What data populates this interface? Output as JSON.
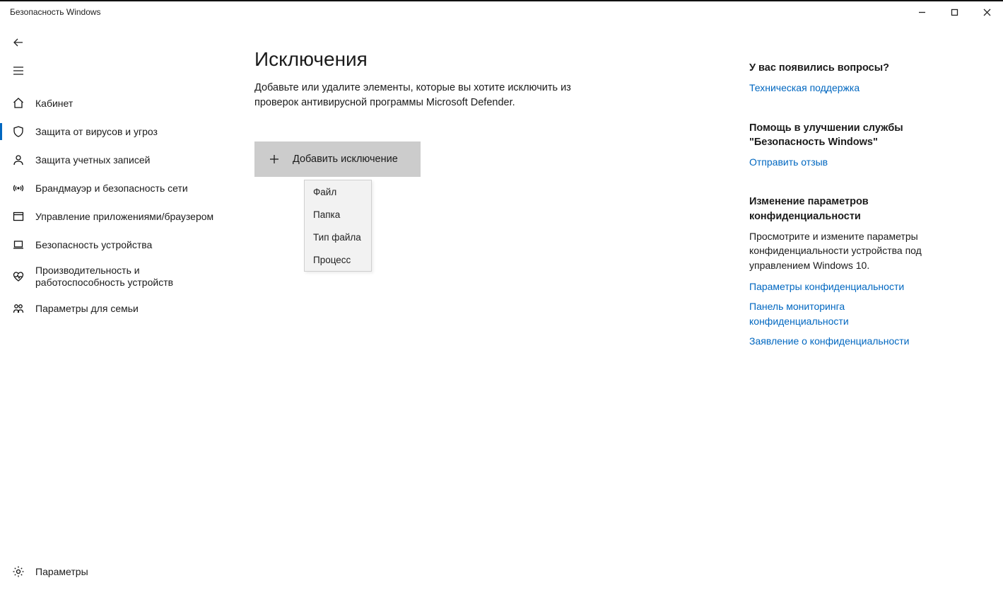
{
  "window": {
    "title": "Безопасность Windows"
  },
  "sidebar": {
    "items": [
      {
        "id": "home",
        "label": "Кабинет"
      },
      {
        "id": "virus",
        "label": "Защита от вирусов и угроз"
      },
      {
        "id": "account",
        "label": "Защита учетных записей"
      },
      {
        "id": "firewall",
        "label": "Брандмауэр и безопасность сети"
      },
      {
        "id": "appbrowser",
        "label": "Управление приложениями/браузером"
      },
      {
        "id": "device",
        "label": "Безопасность устройства"
      },
      {
        "id": "perf",
        "label": "Производительность и работоспособность устройств"
      },
      {
        "id": "family",
        "label": "Параметры для семьи"
      }
    ],
    "settings_label": "Параметры"
  },
  "main": {
    "title": "Исключения",
    "description": "Добавьте или удалите элементы, которые вы хотите исключить из проверок антивирусной программы Microsoft Defender.",
    "add_button": "Добавить исключение",
    "dropdown": [
      "Файл",
      "Папка",
      "Тип файла",
      "Процесс"
    ]
  },
  "right": {
    "s1": {
      "head": "У вас появились вопросы?",
      "link1": "Техническая поддержка"
    },
    "s2": {
      "head": "Помощь в улучшении службы \"Безопасность Windows\"",
      "link1": "Отправить отзыв"
    },
    "s3": {
      "head": "Изменение параметров конфиденциальности",
      "text": "Просмотрите и измените параметры конфиденциальности устройства под управлением Windows 10.",
      "link1": "Параметры конфиденциальности",
      "link2": "Панель мониторинга конфиденциальности",
      "link3": "Заявление о конфиденциальности"
    }
  }
}
